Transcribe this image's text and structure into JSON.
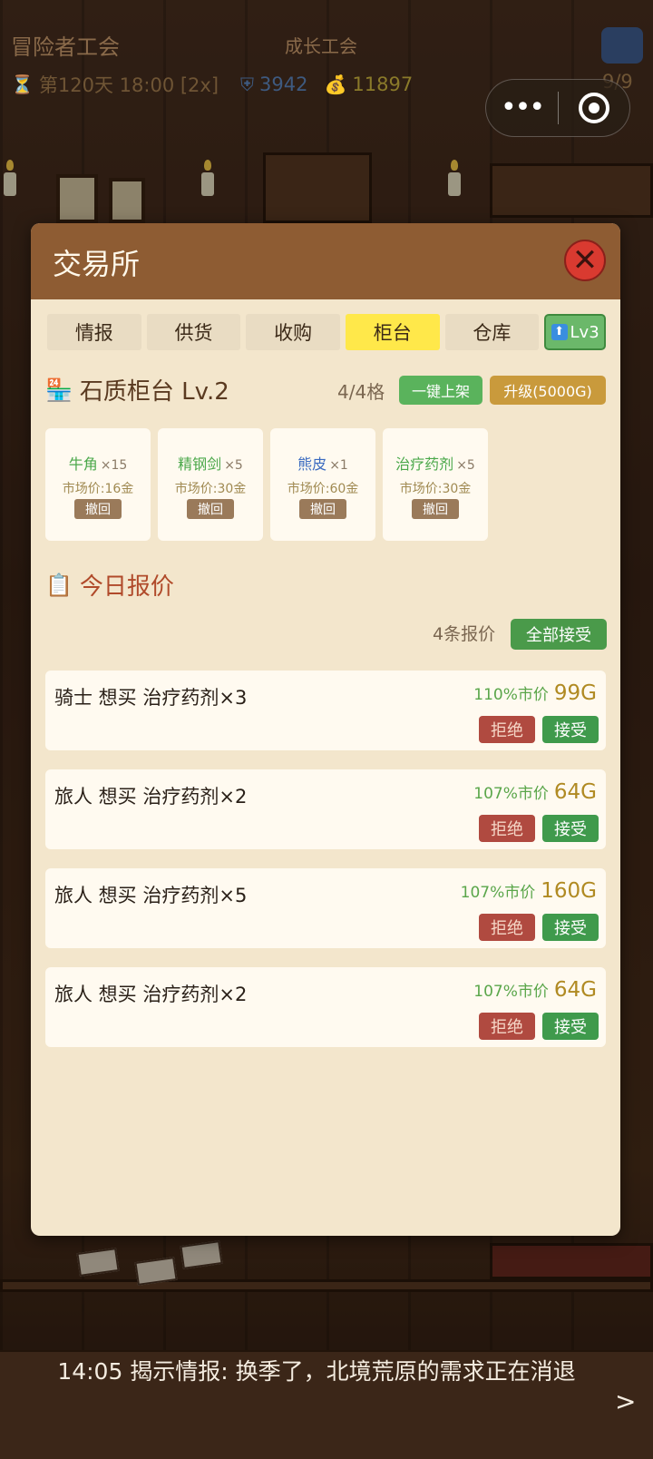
{
  "topbar": {
    "guild_name": "冒险者工会",
    "center_title": "成长工会",
    "day_time": "第120天 18:00 [2x]",
    "defense": "3942",
    "gold": "11897",
    "members": "9/9"
  },
  "modal": {
    "title": "交易所",
    "close_label": "✕",
    "tabs": [
      {
        "label": "情报"
      },
      {
        "label": "供货"
      },
      {
        "label": "收购"
      },
      {
        "label": "柜台",
        "active": true
      },
      {
        "label": "仓库"
      },
      {
        "label": "Lv3"
      }
    ],
    "counter": {
      "icon": "🏪",
      "title": "石质柜台 Lv.2",
      "slots": "4/4格",
      "list_all_label": "一键上架",
      "upgrade_label": "升级(5000G)",
      "items": [
        {
          "name": "牛角",
          "qty": "×15",
          "price": "市场价:16金",
          "recall": "撤回",
          "color": "#4aa84a"
        },
        {
          "name": "精钢剑",
          "qty": "×5",
          "price": "市场价:30金",
          "recall": "撤回",
          "color": "#4aa84a"
        },
        {
          "name": "熊皮",
          "qty": "×1",
          "price": "市场价:60金",
          "recall": "撤回",
          "color": "#3a6ac0"
        },
        {
          "name": "治疗药剂",
          "qty": "×5",
          "price": "市场价:30金",
          "recall": "撤回",
          "color": "#4aa84a"
        }
      ]
    },
    "quotes": {
      "icon": "📋",
      "title": "今日报价",
      "count": "4条报价",
      "accept_all_label": "全部接受",
      "offers": [
        {
          "text": "骑士 想买 治疗药剂×3",
          "pct": "110%市价",
          "price": "99G",
          "reject": "拒绝",
          "accept": "接受"
        },
        {
          "text": "旅人 想买 治疗药剂×2",
          "pct": "107%市价",
          "price": "64G",
          "reject": "拒绝",
          "accept": "接受"
        },
        {
          "text": "旅人 想买 治疗药剂×5",
          "pct": "107%市价",
          "price": "160G",
          "reject": "拒绝",
          "accept": "接受"
        },
        {
          "text": "旅人 想买 治疗药剂×2",
          "pct": "107%市价",
          "price": "64G",
          "reject": "拒绝",
          "accept": "接受"
        }
      ]
    }
  },
  "ticker": {
    "text": "14:05 揭示情报: 换季了，北境荒原的需求正在消退",
    "arrow": ">"
  },
  "colors": {
    "modal_header": "#8e5c33",
    "modal_body": "#f3e6cc",
    "active_tab": "#ffe84a",
    "accept": "#3f9a4c",
    "reject": "#b04a40"
  }
}
